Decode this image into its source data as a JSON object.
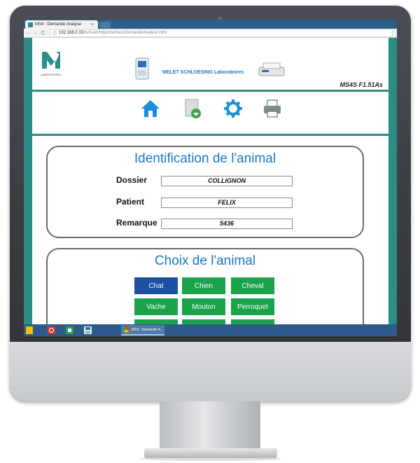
{
  "browser": {
    "tab_title": "MS4 : Demande Analyse",
    "tab_close": "×",
    "url_host": "192.168.0.15",
    "url_path": "/ts/main/http/interface/DemandeAnalyse.html",
    "nav_back": "←",
    "nav_forward": "→",
    "nav_reload": "C",
    "info_icon": "ⓘ"
  },
  "header": {
    "logo_text": "LABORATOIRES",
    "lab_title": "MELET SCHLOESING Laboratoires",
    "version": "MS4S F1.51As"
  },
  "toolbar": {
    "icons": [
      "home-icon",
      "document-download-icon",
      "settings-gear-icon",
      "printer-icon"
    ]
  },
  "identification": {
    "title": "Identification de l'animal",
    "fields": [
      {
        "label": "Dossier",
        "value": "COLLIGNON"
      },
      {
        "label": "Patient",
        "value": "FELIX"
      },
      {
        "label": "Remarque",
        "value": "5436"
      }
    ]
  },
  "animal_choice": {
    "title": "Choix de l'animal",
    "options": [
      {
        "label": "Chat",
        "selected": true
      },
      {
        "label": "Chien",
        "selected": false
      },
      {
        "label": "Cheval",
        "selected": false
      },
      {
        "label": "Vache",
        "selected": false
      },
      {
        "label": "Mouton",
        "selected": false
      },
      {
        "label": "Perroquet",
        "selected": false
      }
    ],
    "selected_color": "#1d4fa0",
    "button_color": "#1aa34a"
  },
  "taskbar": {
    "chrome_label": "MS4 : Demande A..."
  },
  "colors": {
    "teal": "#2c8c86",
    "title_blue": "#1a78c2"
  }
}
